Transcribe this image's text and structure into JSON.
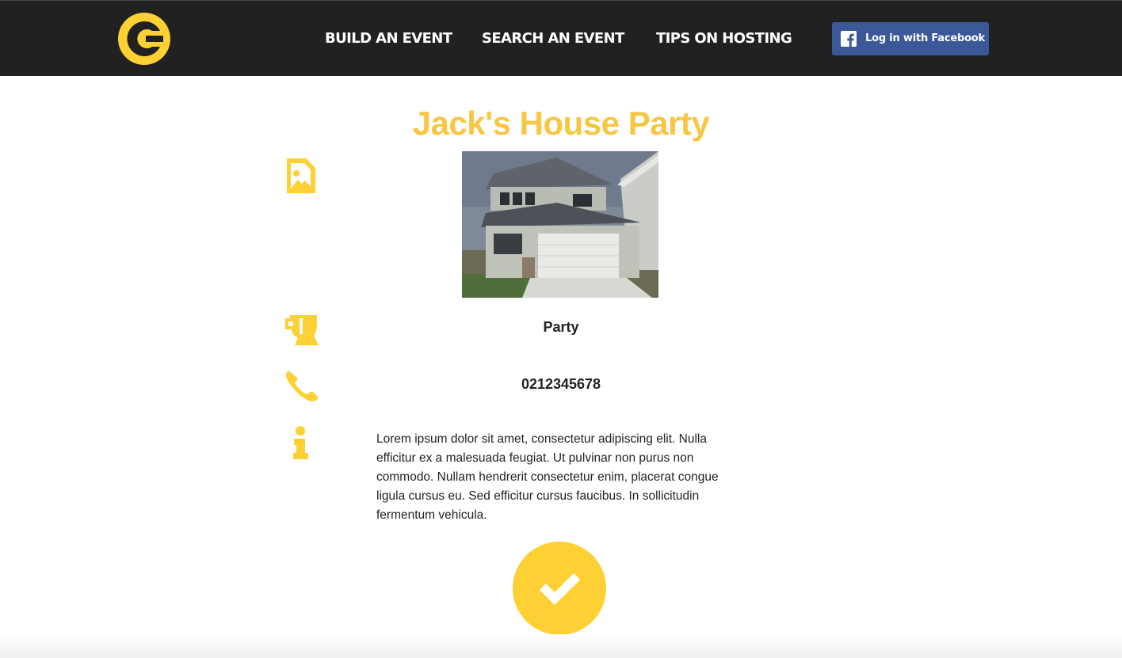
{
  "nav": {
    "logo_icon": "brand-logo-icon",
    "links": [
      {
        "label": "BUILD AN EVENT"
      },
      {
        "label": "SEARCH AN EVENT"
      },
      {
        "label": "TIPS ON HOSTING"
      }
    ],
    "facebook_login_label": "Log in with Facebook"
  },
  "event": {
    "title": "Jack's House Party",
    "image_icon": "image-icon",
    "type_icon": "cup-icon",
    "type": "Party",
    "phone_icon": "phone-icon",
    "phone": "0212345678",
    "info_icon": "info-icon",
    "description": "Lorem ipsum dolor sit amet, consectetur adipiscing elit. Nulla efficitur ex a malesuada feugiat. Ut pulvinar non purus non commodo. Nullam hendrerit consectetur enim, placerat congue ligula cursus eu. Sed efficitur cursus faucibus. In sollicitudin fermentum vehicula."
  },
  "actions": {
    "confirm_icon": "checkmark-icon"
  },
  "colors": {
    "navbar": "#212121",
    "accent": "#fdd034",
    "title": "#f7c744",
    "facebook": "#3b5998"
  }
}
